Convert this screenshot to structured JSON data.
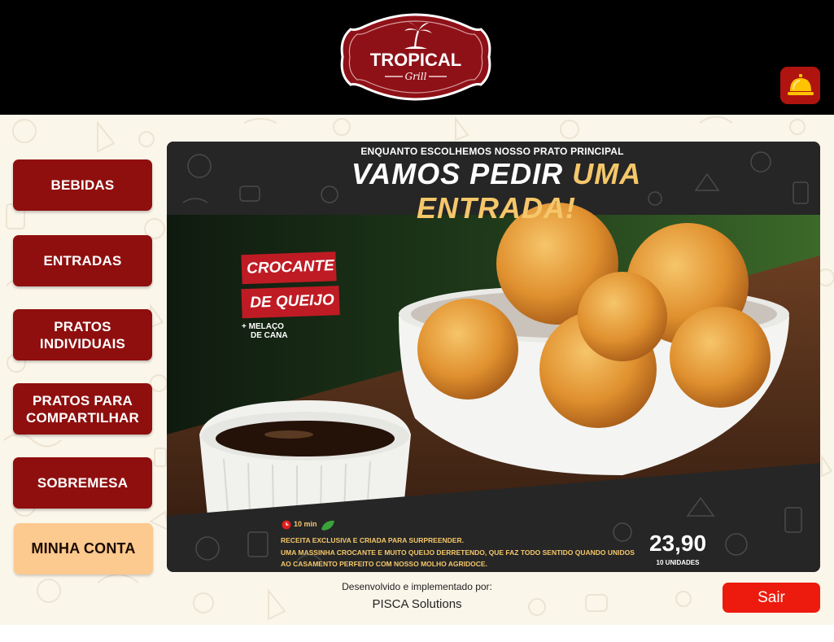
{
  "header": {
    "logo_title": "TROPICAL",
    "logo_subtitle": "Grill",
    "bell_icon": "service-bell-icon",
    "bell_color": "#ffc400"
  },
  "menu": {
    "items": [
      {
        "label": "BEBIDAS"
      },
      {
        "label": "ENTRADAS"
      },
      {
        "label": "PRATOS INDIVIDUAIS"
      },
      {
        "label": "PRATOS PARA COMPARTILHAR"
      },
      {
        "label": "SOBREMESA"
      }
    ],
    "account_label": "MINHA CONTA"
  },
  "banner": {
    "kicker": "ENQUANTO ESCOLHEMOS NOSSO PRATO PRINCIPAL",
    "headline_part1": "VAMOS PEDIR",
    "headline_part2": "UMA ENTRADA!",
    "dish_name_line1": "CROCANTE",
    "dish_name_line2": "DE QUEIJO",
    "dish_side_line1": "+ MELAÇO",
    "dish_side_line2": "DE CANA",
    "prep_time": "10 min",
    "description_line1": "RECEITA EXCLUSIVA E CRIADA PARA SURPREENDER.",
    "description_line2": "UMA MASSINHA CROCANTE E MUITO QUEIJO DERRETENDO, QUE FAZ TODO SENTIDO QUANDO UNIDOS",
    "description_line3": "AO CASAMENTO PERFEITO COM NOSSO MOLHO AGRIDOCE.",
    "price": "23,90",
    "quantity": "10 UNIDADES"
  },
  "footer": {
    "developed_by_label": "Desenvolvido e implementado por:",
    "company": "PISCA Solutions",
    "exit_label": "Sair"
  },
  "colors": {
    "brand_red": "#8f0f0f",
    "account_peach": "#fcc98e",
    "exit_red": "#ec1b0d",
    "accent_gold": "#f5c76a"
  }
}
